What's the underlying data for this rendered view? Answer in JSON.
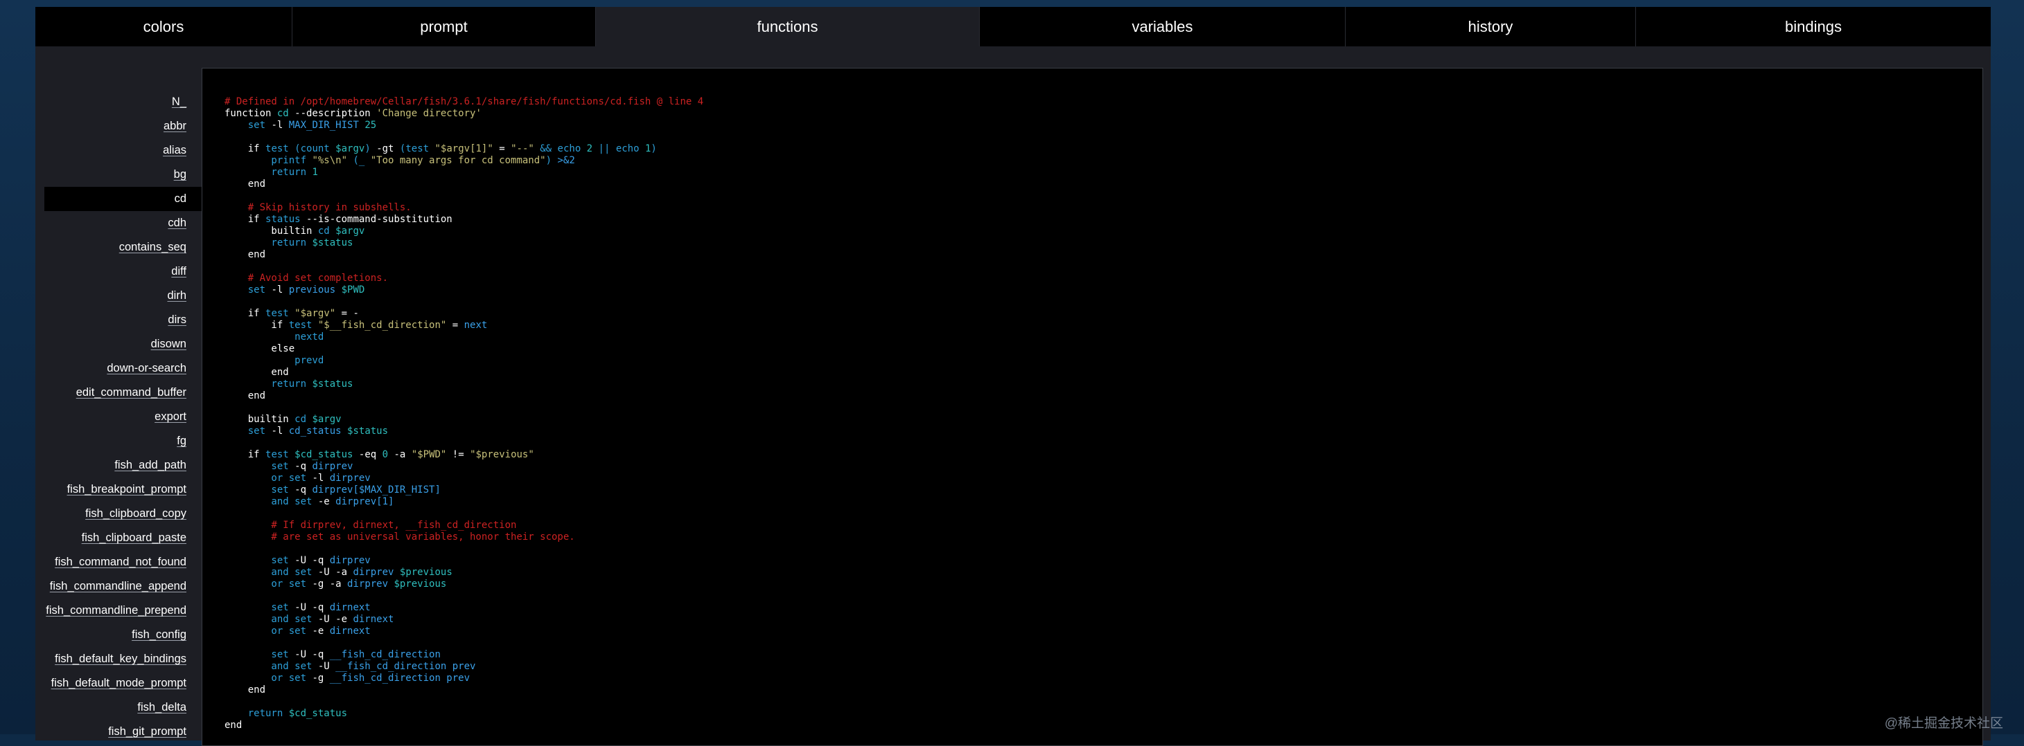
{
  "tabs": [
    {
      "label": "colors",
      "active": false
    },
    {
      "label": "prompt",
      "active": false
    },
    {
      "label": "functions",
      "active": true
    },
    {
      "label": "variables",
      "active": false
    },
    {
      "label": "history",
      "active": false
    },
    {
      "label": "bindings",
      "active": false
    }
  ],
  "functions": {
    "selected": "cd",
    "items": [
      "N_",
      "abbr",
      "alias",
      "bg",
      "cd",
      "cdh",
      "contains_seq",
      "diff",
      "dirh",
      "dirs",
      "disown",
      "down-or-search",
      "edit_command_buffer",
      "export",
      "fg",
      "fish_add_path",
      "fish_breakpoint_prompt",
      "fish_clipboard_copy",
      "fish_clipboard_paste",
      "fish_command_not_found",
      "fish_commandline_append",
      "fish_commandline_prepend",
      "fish_config",
      "fish_default_key_bindings",
      "fish_default_mode_prompt",
      "fish_delta",
      "fish_git_prompt"
    ]
  },
  "code": {
    "lines": [
      [
        [
          "cm",
          "# Defined in /opt/homebrew/Cellar/fish/3.6.1/share/fish/functions/cd.fish @ line 4"
        ]
      ],
      [
        [
          "cmd",
          "function "
        ],
        [
          "vr",
          "cd"
        ],
        [
          "cmd",
          " --description "
        ],
        [
          "q",
          "'Change directory'"
        ]
      ],
      [
        [
          "bi",
          "    set"
        ],
        [
          "cmd",
          " -l "
        ],
        [
          "arg",
          "MAX_DIR_HIST"
        ],
        [
          "nb",
          " 25"
        ]
      ],
      [
        [
          "cmd",
          ""
        ]
      ],
      [
        [
          "cmd",
          "    if "
        ],
        [
          "bi",
          "test"
        ],
        [
          "bi",
          " (count "
        ],
        [
          "vr",
          "$argv"
        ],
        [
          "bi",
          ")"
        ],
        [
          "cmd",
          " -gt "
        ],
        [
          "bi",
          "(test "
        ],
        [
          "q",
          "\"$argv[1]\""
        ],
        [
          "cmd",
          " = "
        ],
        [
          "q",
          "\"--\""
        ],
        [
          "bi",
          " && echo "
        ],
        [
          "nb",
          "2"
        ],
        [
          "bi",
          " || echo "
        ],
        [
          "nb",
          "1"
        ],
        [
          "bi",
          ")"
        ]
      ],
      [
        [
          "bi",
          "        printf "
        ],
        [
          "q",
          "\"%s\\n\""
        ],
        [
          "bi",
          " (_ "
        ],
        [
          "q",
          "\"Too many args for cd command\""
        ],
        [
          "bi",
          ")"
        ],
        [
          "arg",
          " >&2"
        ]
      ],
      [
        [
          "bi",
          "        return "
        ],
        [
          "nb",
          "1"
        ]
      ],
      [
        [
          "cmd",
          "    end"
        ]
      ],
      [
        [
          "cmd",
          ""
        ]
      ],
      [
        [
          "cm",
          "    # Skip history in subshells."
        ]
      ],
      [
        [
          "cmd",
          "    if "
        ],
        [
          "bi",
          "status"
        ],
        [
          "cmd",
          " --is-command-substitution"
        ]
      ],
      [
        [
          "cmd",
          "        builtin "
        ],
        [
          "bi",
          "cd "
        ],
        [
          "vr",
          "$argv"
        ]
      ],
      [
        [
          "bi",
          "        return "
        ],
        [
          "vr",
          "$status"
        ]
      ],
      [
        [
          "cmd",
          "    end"
        ]
      ],
      [
        [
          "cmd",
          ""
        ]
      ],
      [
        [
          "cm",
          "    # Avoid set completions."
        ]
      ],
      [
        [
          "bi",
          "    set"
        ],
        [
          "cmd",
          " -l "
        ],
        [
          "arg",
          "previous "
        ],
        [
          "vr",
          "$PWD"
        ]
      ],
      [
        [
          "cmd",
          ""
        ]
      ],
      [
        [
          "cmd",
          "    if "
        ],
        [
          "bi",
          "test "
        ],
        [
          "q",
          "\"$argv\""
        ],
        [
          "cmd",
          " = -"
        ]
      ],
      [
        [
          "cmd",
          "        if "
        ],
        [
          "bi",
          "test "
        ],
        [
          "q",
          "\"$__fish_cd_direction\""
        ],
        [
          "cmd",
          " = "
        ],
        [
          "arg",
          "next"
        ]
      ],
      [
        [
          "bi",
          "            nextd"
        ]
      ],
      [
        [
          "cmd",
          "        else"
        ]
      ],
      [
        [
          "bi",
          "            prevd"
        ]
      ],
      [
        [
          "cmd",
          "        end"
        ]
      ],
      [
        [
          "bi",
          "        return "
        ],
        [
          "vr",
          "$status"
        ]
      ],
      [
        [
          "cmd",
          "    end"
        ]
      ],
      [
        [
          "cmd",
          ""
        ]
      ],
      [
        [
          "cmd",
          "    builtin "
        ],
        [
          "bi",
          "cd "
        ],
        [
          "vr",
          "$argv"
        ]
      ],
      [
        [
          "bi",
          "    set"
        ],
        [
          "cmd",
          " -l "
        ],
        [
          "arg",
          "cd_status "
        ],
        [
          "vr",
          "$status"
        ]
      ],
      [
        [
          "cmd",
          ""
        ]
      ],
      [
        [
          "cmd",
          "    if "
        ],
        [
          "bi",
          "test "
        ],
        [
          "vr",
          "$cd_status"
        ],
        [
          "cmd",
          " -eq "
        ],
        [
          "nb",
          "0"
        ],
        [
          "cmd",
          " -a "
        ],
        [
          "q",
          "\"$PWD\""
        ],
        [
          "cmd",
          " != "
        ],
        [
          "q",
          "\"$previous\""
        ]
      ],
      [
        [
          "bi",
          "        set"
        ],
        [
          "cmd",
          " -q "
        ],
        [
          "arg",
          "dirprev"
        ]
      ],
      [
        [
          "bi",
          "        or set"
        ],
        [
          "cmd",
          " -l "
        ],
        [
          "arg",
          "dirprev"
        ]
      ],
      [
        [
          "bi",
          "        set"
        ],
        [
          "cmd",
          " -q "
        ],
        [
          "arg",
          "dirprev[$MAX_DIR_HIST]"
        ]
      ],
      [
        [
          "bi",
          "        and set"
        ],
        [
          "cmd",
          " -e "
        ],
        [
          "arg",
          "dirprev[1]"
        ]
      ],
      [
        [
          "cmd",
          ""
        ]
      ],
      [
        [
          "cm",
          "        # If dirprev, dirnext, __fish_cd_direction"
        ]
      ],
      [
        [
          "cm",
          "        # are set as universal variables, honor their scope."
        ]
      ],
      [
        [
          "cmd",
          ""
        ]
      ],
      [
        [
          "bi",
          "        set"
        ],
        [
          "cmd",
          " -U -q "
        ],
        [
          "arg",
          "dirprev"
        ]
      ],
      [
        [
          "bi",
          "        and set"
        ],
        [
          "cmd",
          " -U -a "
        ],
        [
          "arg",
          "dirprev "
        ],
        [
          "vr",
          "$previous"
        ]
      ],
      [
        [
          "bi",
          "        or set"
        ],
        [
          "cmd",
          " -g -a "
        ],
        [
          "arg",
          "dirprev "
        ],
        [
          "vr",
          "$previous"
        ]
      ],
      [
        [
          "cmd",
          ""
        ]
      ],
      [
        [
          "bi",
          "        set"
        ],
        [
          "cmd",
          " -U -q "
        ],
        [
          "arg",
          "dirnext"
        ]
      ],
      [
        [
          "bi",
          "        and set"
        ],
        [
          "cmd",
          " -U -e "
        ],
        [
          "arg",
          "dirnext"
        ]
      ],
      [
        [
          "bi",
          "        or set"
        ],
        [
          "cmd",
          " -e "
        ],
        [
          "arg",
          "dirnext"
        ]
      ],
      [
        [
          "cmd",
          ""
        ]
      ],
      [
        [
          "bi",
          "        set"
        ],
        [
          "cmd",
          " -U -q "
        ],
        [
          "arg",
          "__fish_cd_direction"
        ]
      ],
      [
        [
          "bi",
          "        and set"
        ],
        [
          "cmd",
          " -U "
        ],
        [
          "arg",
          "__fish_cd_direction prev"
        ]
      ],
      [
        [
          "bi",
          "        or set"
        ],
        [
          "cmd",
          " -g "
        ],
        [
          "arg",
          "__fish_cd_direction prev"
        ]
      ],
      [
        [
          "cmd",
          "    end"
        ]
      ],
      [
        [
          "cmd",
          ""
        ]
      ],
      [
        [
          "bi",
          "    return "
        ],
        [
          "vr",
          "$cd_status"
        ]
      ],
      [
        [
          "cmd",
          "end"
        ]
      ]
    ]
  },
  "watermark": "@稀土掘金技术社区",
  "colors": {
    "background": "#0e2a46",
    "panel": "#1d1e24",
    "code_bg": "#000000",
    "comment": "#cc2222",
    "builtin": "#2d9fd8",
    "string": "#c7c07a",
    "variable": "#2fbfbf"
  }
}
